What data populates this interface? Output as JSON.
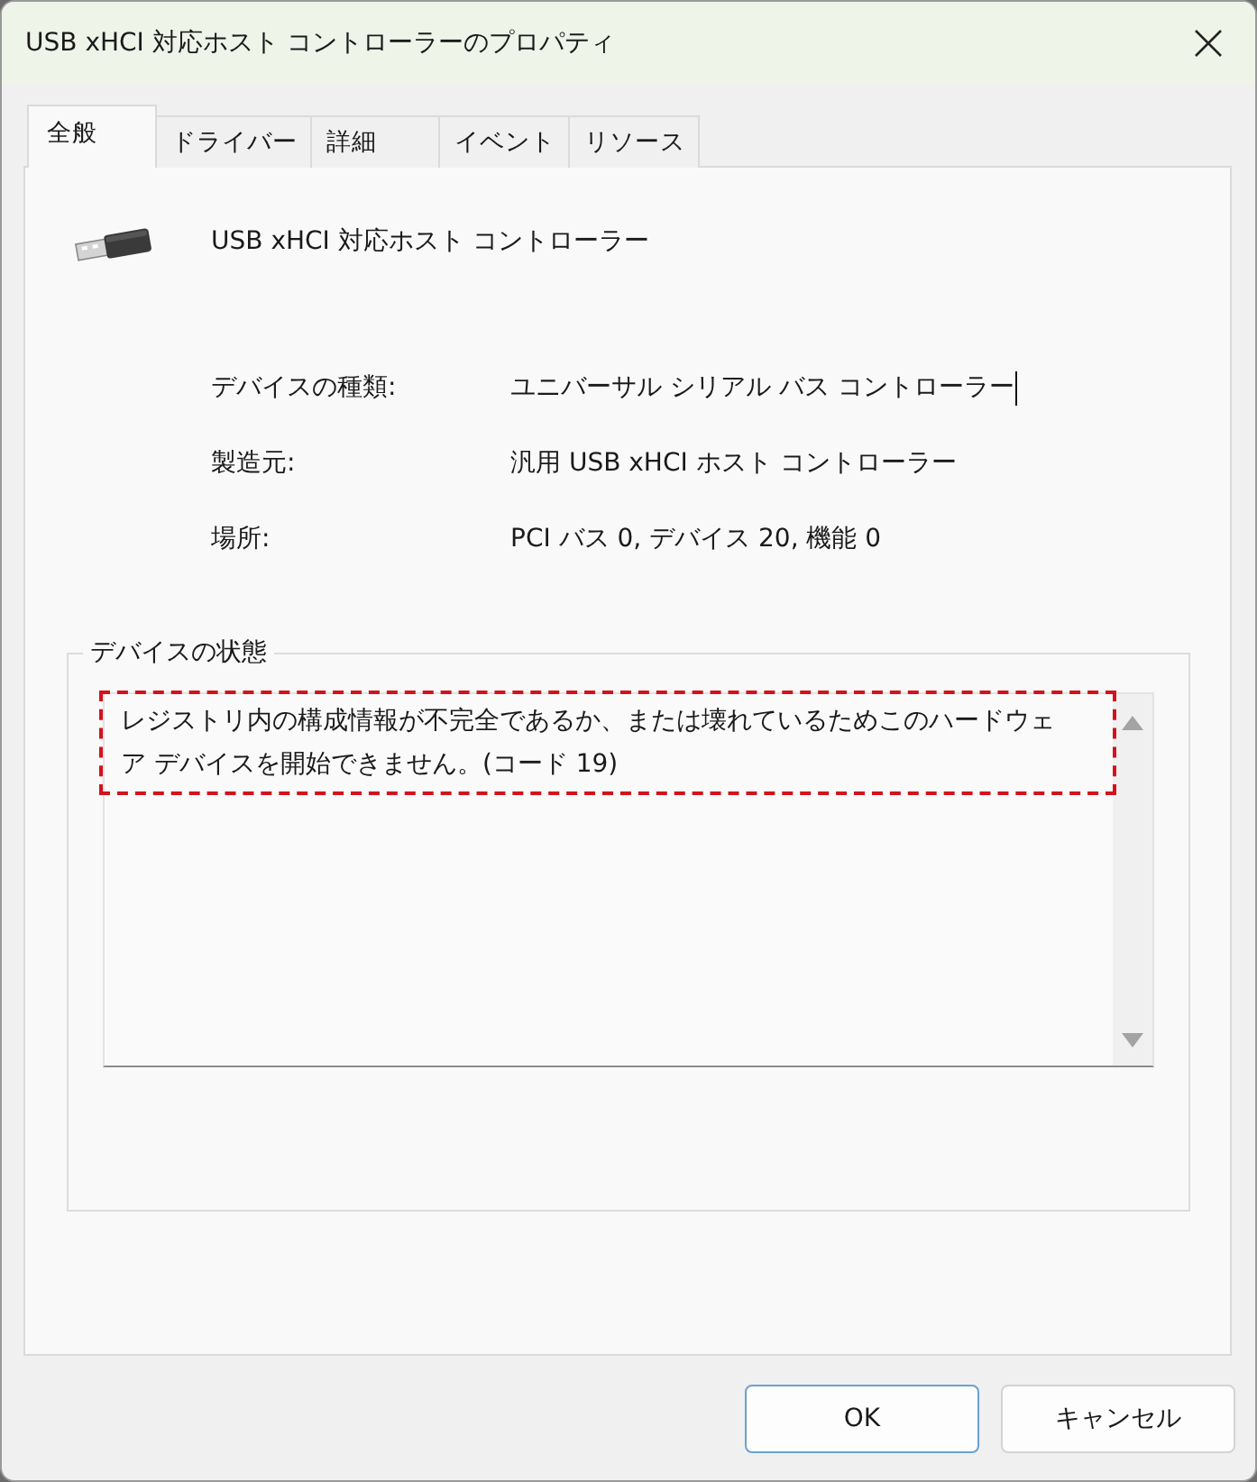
{
  "window": {
    "title": "USB xHCI 対応ホスト コントローラーのプロパティ"
  },
  "tabs": [
    {
      "label": "全般",
      "selected": true
    },
    {
      "label": "ドライバー",
      "selected": false
    },
    {
      "label": "詳細",
      "selected": false
    },
    {
      "label": "イベント",
      "selected": false
    },
    {
      "label": "リソース",
      "selected": false
    }
  ],
  "device": {
    "name": "USB xHCI 対応ホスト コントローラー"
  },
  "properties": [
    {
      "label": "デバイスの種類:",
      "value": "ユニバーサル シリアル バス コントローラー",
      "focused": true
    },
    {
      "label": "製造元:",
      "value": "汎用 USB xHCI ホスト コントローラー",
      "focused": false
    },
    {
      "label": "場所:",
      "value": "PCI バス 0, デバイス 20, 機能 0",
      "focused": false
    }
  ],
  "device_status": {
    "title": "デバイスの状態",
    "text": "レジストリ内の構成情報が不完全であるか、または壊れているためこのハードウェア デバイスを開始できません。(コード 19)",
    "highlighted": true
  },
  "buttons": [
    {
      "label": "OK",
      "default": true
    },
    {
      "label": "キャンセル",
      "default": false
    }
  ]
}
